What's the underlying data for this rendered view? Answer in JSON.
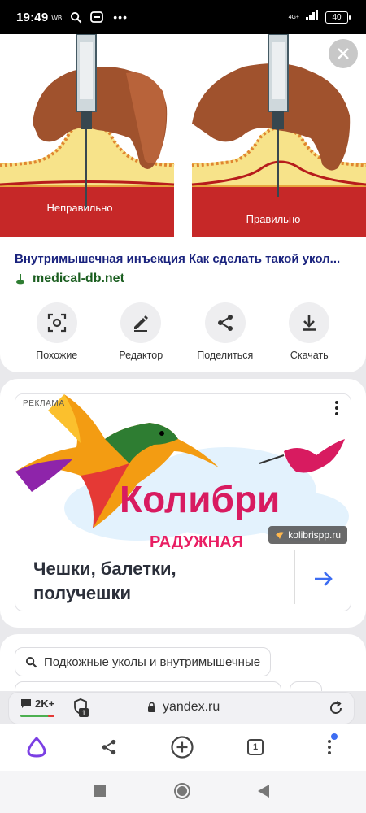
{
  "status_bar": {
    "time": "19:49",
    "carrier_tag": "WB",
    "network": "4G+",
    "battery": "40"
  },
  "image_card": {
    "illustration_labels": {
      "left": "Неправильно",
      "right": "Правильно"
    },
    "title": "Внутримышечная инъекция Как сделать такой укол...",
    "source": "medical-db.net",
    "actions": [
      {
        "label": "Похожие",
        "icon": "similar-search-icon"
      },
      {
        "label": "Редактор",
        "icon": "pencil-icon"
      },
      {
        "label": "Поделиться",
        "icon": "share-icon"
      },
      {
        "label": "Скачать",
        "icon": "download-icon"
      }
    ]
  },
  "ad": {
    "label": "РЕКЛАМА",
    "image_text": {
      "brand": "Колибри",
      "subtitle": "РАДУЖНАЯ"
    },
    "domain": "kolibrispp.ru",
    "text": "Чешки, балетки, получешки"
  },
  "related": {
    "query": "Подкожные уколы и внутримышечные"
  },
  "browser": {
    "comments": "2K+",
    "shield_count": "1",
    "url": "yandex.ru",
    "tab_count": "1"
  },
  "colors": {
    "title": "#1a237e",
    "source": "#1b5e20",
    "accent": "#3d6df2",
    "alice": "#7b3fe4"
  }
}
